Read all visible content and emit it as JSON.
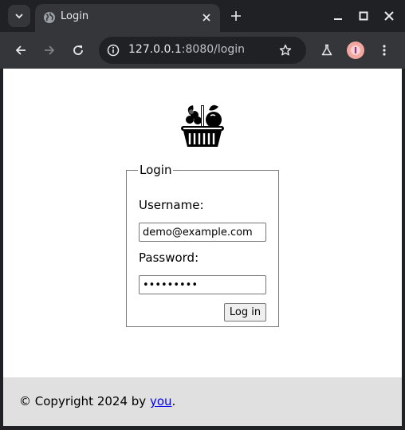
{
  "browser": {
    "tab": {
      "title": "Login",
      "favicon": "globe-icon"
    },
    "address": {
      "host": "127.0.0.1",
      "rest": ":8080/login"
    },
    "colors": {
      "frame": "#202124",
      "toolbar": "#35363a",
      "profile": "#f2a7a0"
    }
  },
  "page": {
    "logo": "fruit-basket-icon",
    "form": {
      "legend": "Login",
      "username_label": "Username:",
      "username_value": "demo@example.com",
      "password_label": "Password:",
      "password_value": "•••••••••",
      "submit_label": "Log in"
    },
    "footer": {
      "text_before": "© Copyright 2024 by ",
      "link_text": "you",
      "text_after": "."
    }
  }
}
